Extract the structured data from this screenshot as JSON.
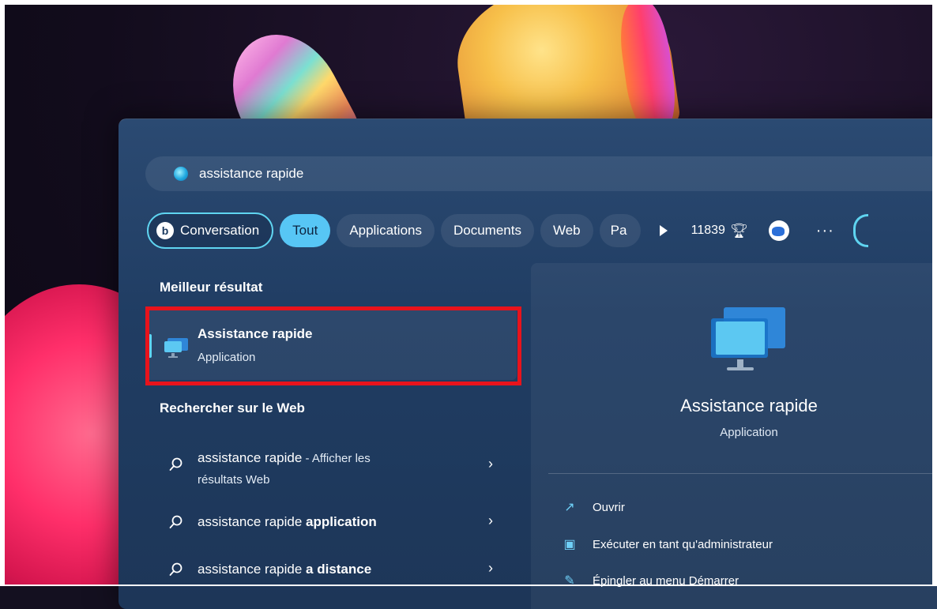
{
  "search": {
    "query": "assistance rapide"
  },
  "filters": {
    "conversation": "Conversation",
    "tout": "Tout",
    "applications": "Applications",
    "documents": "Documents",
    "web": "Web",
    "truncated": "Pa"
  },
  "status": {
    "points": "11839",
    "more": "···"
  },
  "results": {
    "best_heading": "Meilleur résultat",
    "best_title": "Assistance rapide",
    "best_subtitle": "Application",
    "web_heading": "Rechercher sur le Web",
    "web_items": [
      {
        "normal": "assistance rapide",
        "suffix": " - Afficher les",
        "line2": "résultats Web"
      },
      {
        "normal": "assistance rapide ",
        "bold": "application"
      },
      {
        "normal": "assistance rapide ",
        "bold": "a distance"
      }
    ]
  },
  "preview": {
    "title": "Assistance rapide",
    "subtitle": "Application",
    "actions": [
      {
        "label": "Ouvrir",
        "icon": "open-external-icon"
      },
      {
        "label": "Exécuter en tant qu'administrateur",
        "icon": "run-as-admin-icon"
      },
      {
        "label": "Épingler au menu Démarrer",
        "icon": "pin-icon"
      }
    ]
  },
  "colors": {
    "accent": "#57c6f5",
    "highlight": "#e8131c"
  }
}
